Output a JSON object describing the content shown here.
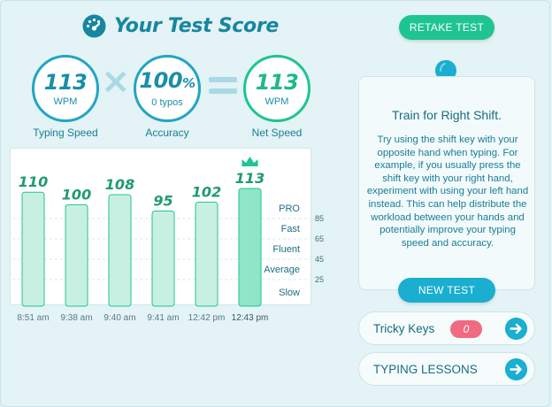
{
  "header": {
    "title": "Your Test Score",
    "icon": "speedometer-icon",
    "retake_label": "RETAKE TEST"
  },
  "stats": {
    "speed": {
      "value": "113",
      "unit": "WPM",
      "label": "Typing Speed"
    },
    "accuracy": {
      "value": "100",
      "suffix": "%",
      "detail": "0 typos",
      "label": "Accuracy"
    },
    "net": {
      "value": "113",
      "unit": "WPM",
      "label": "Net Speed"
    },
    "operators": [
      "×",
      "="
    ]
  },
  "chart_data": {
    "type": "bar",
    "categories": [
      "8:51 am",
      "9:38 am",
      "9:40 am",
      "9:41 am",
      "12:42 pm",
      "12:43 pm"
    ],
    "values": [
      110,
      100,
      108,
      95,
      102,
      113
    ],
    "value_labels": [
      "110",
      "100",
      "108",
      "95",
      "102",
      "113"
    ],
    "current_index": 5,
    "crown_icon": "crown-icon",
    "ylim": [
      0,
      150
    ],
    "thresholds": [
      85,
      65,
      45,
      25
    ],
    "threshold_labels": [
      "85",
      "65",
      "45",
      "25"
    ],
    "tiers": [
      "PRO",
      "Fast",
      "Fluent",
      "Average",
      "Slow"
    ],
    "grid": "dashed"
  },
  "tip": {
    "icon": "lightbulb-icon",
    "title": "Train for Right Shift.",
    "body": "Try using the shift key with your opposite hand when typing. For example, if you usually press the shift key with your right hand, experiment with using your left hand instead. This can help distribute the workload between your hands and potentially improve your typing speed and accuracy.",
    "button": "NEW TEST"
  },
  "links": {
    "tricky_keys": {
      "label": "Tricky Keys",
      "count": "0"
    },
    "lessons": {
      "label": "TYPING LESSONS"
    },
    "arrow_icon": "arrow-right-icon"
  },
  "colors": {
    "background": "#e3f3f6",
    "primary": "#1aaed0",
    "green": "#1fc493",
    "bar_fill": "#c8f0e2",
    "bar_current": "#8fe5c8",
    "badge": "#f16a82"
  }
}
